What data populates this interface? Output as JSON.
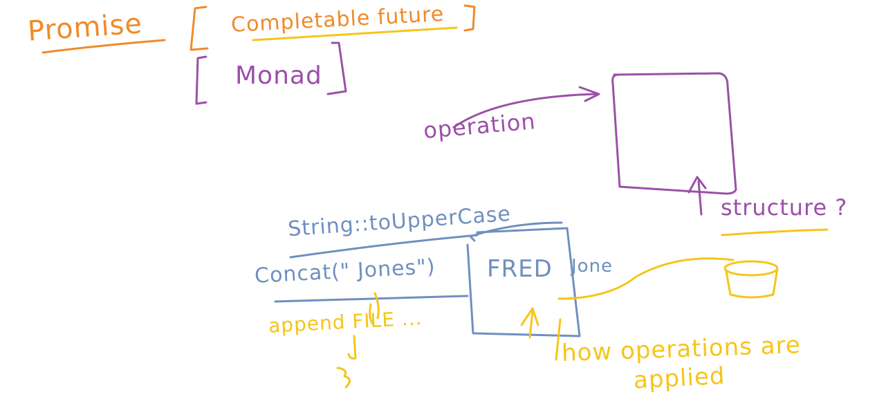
{
  "colors": {
    "orange": "#F08A2A",
    "yellow": "#F5C518",
    "purple": "#9B4FA8",
    "blue": "#6F8FBF",
    "background": "#ffffff"
  },
  "labels": {
    "promise": "Promise",
    "completable_future": "Completable future",
    "monad": "Monad",
    "operation": "operation",
    "structure": "structure ?",
    "to_upper_case": "String::toUpperCase",
    "concat": "Concat(\" Jones\")",
    "fred": "FRED",
    "jone": "Jone",
    "append_file": "append FILE ...",
    "how_operations": "how operations are",
    "applied": "applied"
  }
}
